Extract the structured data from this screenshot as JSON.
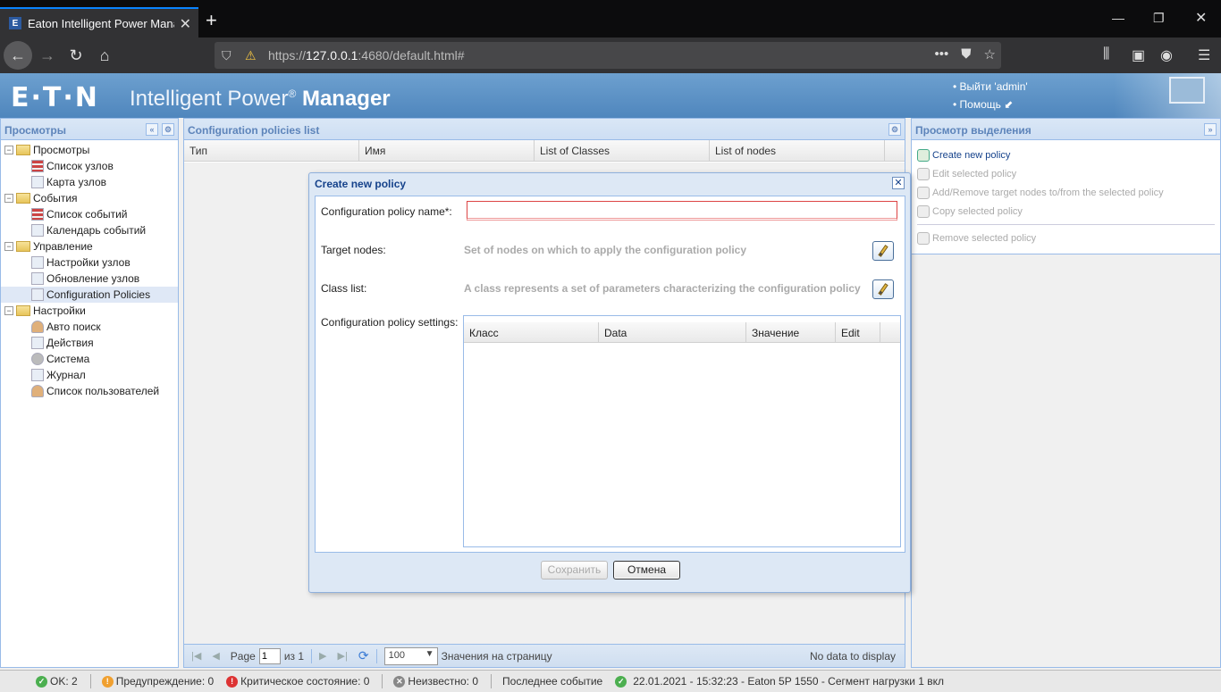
{
  "browser": {
    "tab_title": "Eaton Intelligent Power Manager",
    "url_prefix": "https://",
    "url_host": "127.0.0.1",
    "url_rest": ":4680/default.html#"
  },
  "header": {
    "logo": "E·T·N",
    "title_light": "Intelligent Power",
    "title_reg": "®",
    "title_bold": "Manager",
    "logout": "• Выйти 'admin'",
    "help": "• Помощь"
  },
  "left_panel": {
    "title": "Просмотры",
    "tree": [
      {
        "label": "Просмотры",
        "type": "folder"
      },
      {
        "label": "Список узлов",
        "type": "leaf",
        "icon": "list"
      },
      {
        "label": "Карта узлов",
        "type": "leaf",
        "icon": "map"
      },
      {
        "label": "События",
        "type": "folder"
      },
      {
        "label": "Список событий",
        "type": "leaf",
        "icon": "list"
      },
      {
        "label": "Календарь событий",
        "type": "leaf",
        "icon": "calendar"
      },
      {
        "label": "Управление",
        "type": "folder"
      },
      {
        "label": "Настройки узлов",
        "type": "leaf",
        "icon": "settings"
      },
      {
        "label": "Обновление узлов",
        "type": "leaf",
        "icon": "update"
      },
      {
        "label": "Configuration Policies",
        "type": "leaf",
        "icon": "policy",
        "selected": true
      },
      {
        "label": "Настройки",
        "type": "folder"
      },
      {
        "label": "Авто поиск",
        "type": "leaf",
        "icon": "user"
      },
      {
        "label": "Действия",
        "type": "leaf",
        "icon": "actions"
      },
      {
        "label": "Система",
        "type": "leaf",
        "icon": "gear"
      },
      {
        "label": "Журнал",
        "type": "leaf",
        "icon": "log"
      },
      {
        "label": "Список пользователей",
        "type": "leaf",
        "icon": "user"
      }
    ]
  },
  "center_panel": {
    "title": "Configuration policies list",
    "columns": [
      "Тип",
      "Имя",
      "List of Classes",
      "List of nodes"
    ],
    "pager": {
      "page_label": "Page",
      "page_value": "1",
      "of_label": "из 1",
      "page_size": "100",
      "page_size_label": "Значения на страницу",
      "empty": "No data to display"
    }
  },
  "right_panel": {
    "title": "Просмотр выделения",
    "actions": [
      {
        "label": "Create new policy",
        "enabled": true
      },
      {
        "label": "Edit selected policy",
        "enabled": false
      },
      {
        "label": "Add/Remove target nodes to/from the selected policy",
        "enabled": false
      },
      {
        "label": "Copy selected policy",
        "enabled": false
      },
      {
        "label": "Remove selected policy",
        "enabled": false
      }
    ]
  },
  "modal": {
    "title": "Create new policy",
    "name_label": "Configuration policy name*:",
    "name_value": "",
    "target_label": "Target nodes:",
    "target_hint": "Set of nodes on which to apply the configuration policy",
    "class_label": "Class list:",
    "class_hint": "A class represents a set of parameters characterizing the configuration policy",
    "settings_label": "Configuration policy settings:",
    "settings_columns": [
      "Класс",
      "Data",
      "Значение",
      "Edit"
    ],
    "save": "Сохранить",
    "cancel": "Отмена"
  },
  "statusbar": {
    "ok": "OK: 2",
    "warning": "Предупреждение: 0",
    "critical": "Критическое состояние: 0",
    "unknown": "Неизвестно: 0",
    "last_event_label": "Последнее событие",
    "last_event": "22.01.2021 - 15:32:23 - Eaton 5P 1550 - Сегмент нагрузки 1 вкл"
  },
  "colors": {
    "accent": "#4f86bd",
    "panel_border": "#99bbe8",
    "panel_title": "#5d84ba"
  }
}
